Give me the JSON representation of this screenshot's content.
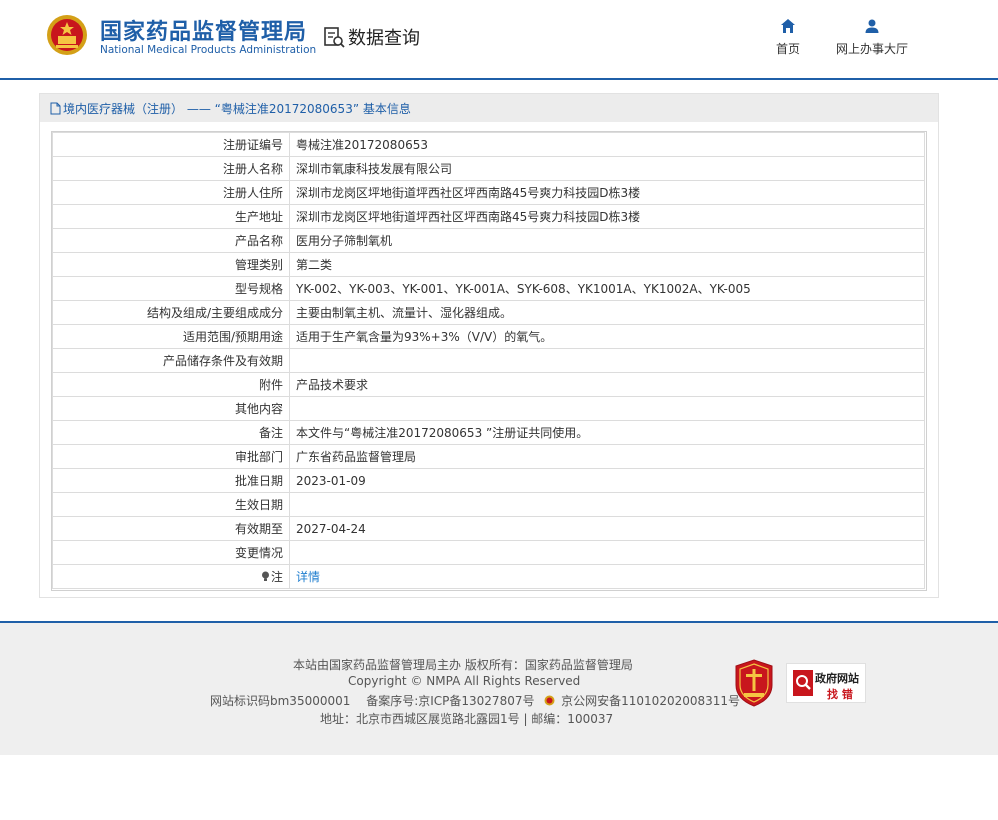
{
  "header": {
    "org_cn": "国家药品监督管理局",
    "org_en": "National Medical Products Administration",
    "data_query": "数据查询",
    "nav": [
      {
        "label": "首页",
        "icon": "home-icon"
      },
      {
        "label": "网上办事大厅",
        "icon": "user-icon"
      }
    ],
    "brand_color": "#1f5fa8"
  },
  "panel": {
    "title": "境内医疗器械（注册） —— “粤械注准20172080653” 基本信息",
    "rows": [
      {
        "label": "注册证编号",
        "value": "粤械注准20172080653"
      },
      {
        "label": "注册人名称",
        "value": "深圳市氧康科技发展有限公司"
      },
      {
        "label": "注册人住所",
        "value": "深圳市龙岗区坪地街道坪西社区坪西南路45号爽力科技园D栋3楼"
      },
      {
        "label": "生产地址",
        "value": "深圳市龙岗区坪地街道坪西社区坪西南路45号爽力科技园D栋3楼"
      },
      {
        "label": "产品名称",
        "value": "医用分子筛制氧机"
      },
      {
        "label": "管理类别",
        "value": "第二类"
      },
      {
        "label": "型号规格",
        "value": "YK-002、YK-003、YK-001、YK-001A、SYK-608、YK1001A、YK1002A、YK-005"
      },
      {
        "label": "结构及组成/主要组成成分",
        "value": "主要由制氧主机、流量计、湿化器组成。"
      },
      {
        "label": "适用范围/预期用途",
        "value": "适用于生产氧含量为93%+3%（V/V）的氧气。"
      },
      {
        "label": "产品储存条件及有效期",
        "value": ""
      },
      {
        "label": "附件",
        "value": "产品技术要求"
      },
      {
        "label": "其他内容",
        "value": ""
      },
      {
        "label": "备注",
        "value": "本文件与“粤械注准20172080653 ”注册证共同使用。"
      },
      {
        "label": "审批部门",
        "value": "广东省药品监督管理局"
      },
      {
        "label": "批准日期",
        "value": "2023-01-09"
      },
      {
        "label": "生效日期",
        "value": ""
      },
      {
        "label": "有效期至",
        "value": "2027-04-24"
      },
      {
        "label": "变更情况",
        "value": ""
      }
    ],
    "note_label": "注",
    "note_link": "详情",
    "link_color": "#1f7ecf"
  },
  "footer": {
    "line1": "本站由国家药品监督管理局主办 版权所有：国家药品监督管理局",
    "line2": "Copyright © NMPA All Rights Reserved",
    "line3a": "网站标识码bm35000001　 备案序号:京ICP备13027807号",
    "line3b": "京公网安备11010202008311号",
    "line4": "地址：北京市西城区展览路北露园1号 | 邮编：100037",
    "badge2_line1": "政府网站",
    "badge2_line2": "找 错"
  }
}
